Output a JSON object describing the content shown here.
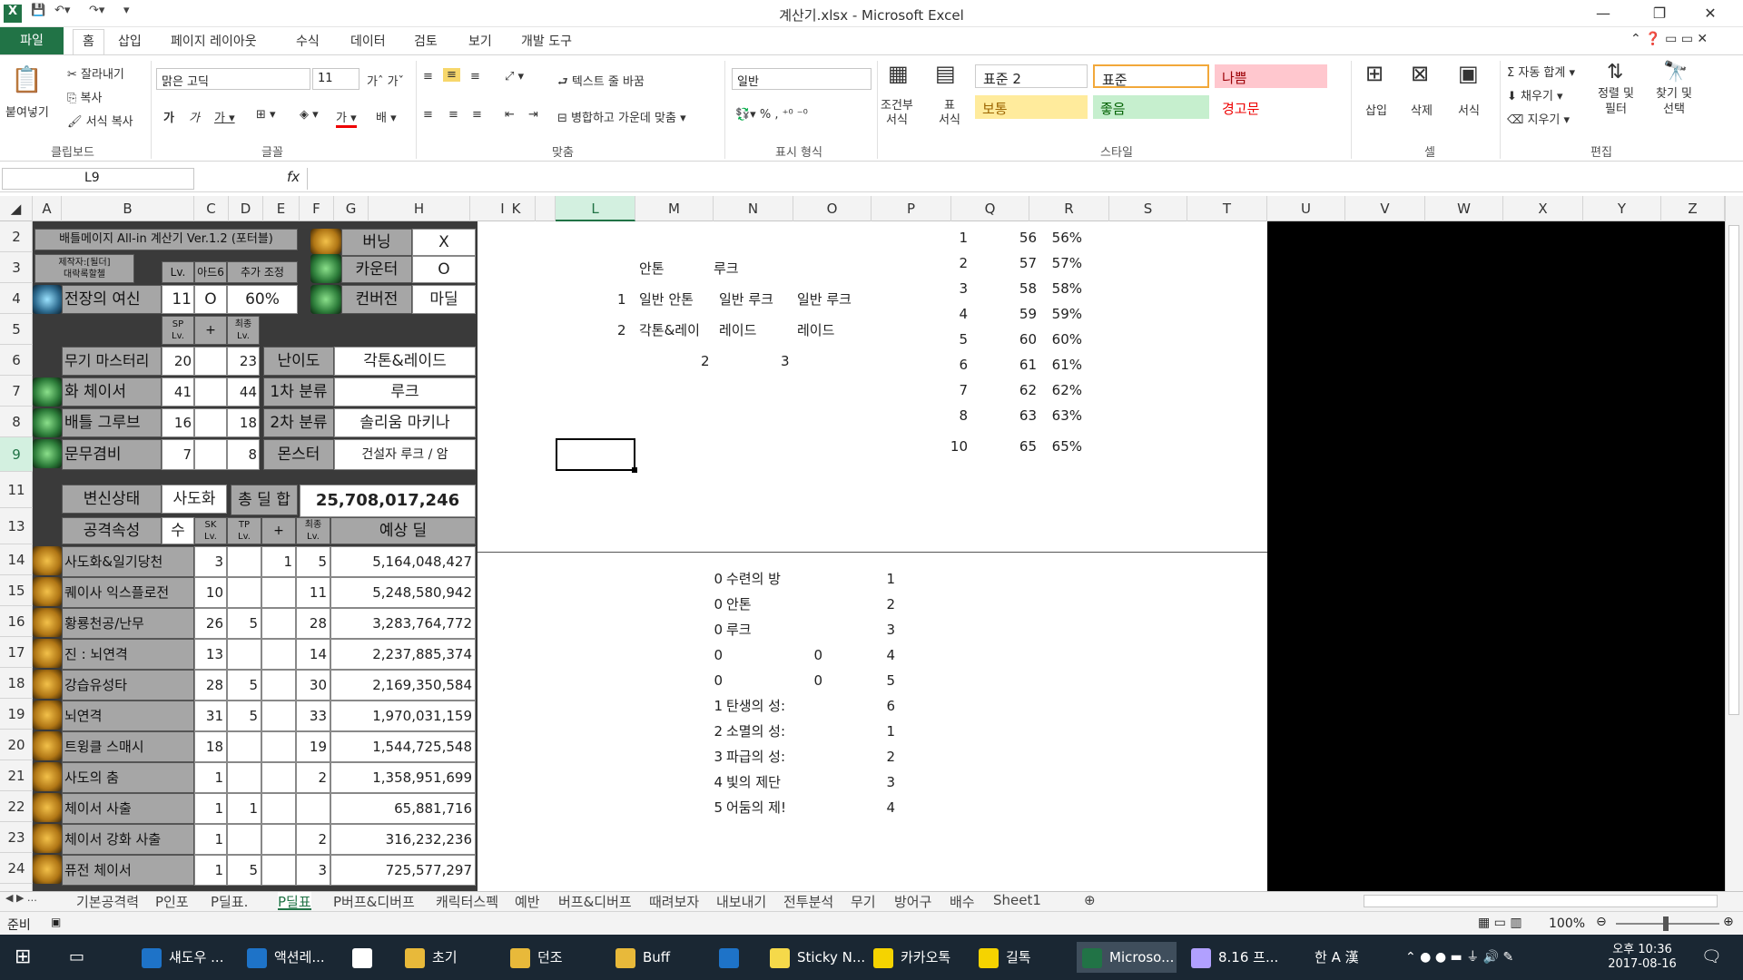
{
  "window": {
    "title": "계산기.xlsx - Microsoft Excel"
  },
  "tabs": [
    "파일",
    "홈",
    "삽입",
    "페이지 레이아웃",
    "수식",
    "데이터",
    "검토",
    "보기",
    "개발 도구"
  ],
  "ribbon": {
    "clipboard": {
      "paste": "붙여넣기",
      "cut": "잘라내기",
      "copy": "복사",
      "format_copy": "서식 복사",
      "label": "클립보드"
    },
    "font": {
      "name": "맑은 고딕",
      "size": "11",
      "label": "글꼴"
    },
    "align": {
      "wrap": "텍스트 줄 바꿈",
      "merge": "병합하고 가운데 맞춤",
      "label": "맞춤"
    },
    "number": {
      "format": "일반",
      "label": "표시 형식"
    },
    "cond": {
      "cond_fmt": "조건부\n서식",
      "table_fmt": "표\n서식"
    },
    "styles": {
      "label": "스타일",
      "s1": "표준 2",
      "s2": "표준",
      "s3": "나쁨",
      "s4": "보통",
      "s5": "좋음",
      "s6": "경고문"
    },
    "cells": {
      "insert": "삽입",
      "delete": "삭제",
      "format": "서식",
      "label": "셀"
    },
    "edit": {
      "autosum": "자동 합계",
      "fill": "채우기",
      "clear": "지우기",
      "sort": "정렬 및\n필터",
      "find": "찾기 및\n선택",
      "label": "편집"
    }
  },
  "formula": {
    "namebox": "L9",
    "fx": "fx"
  },
  "columns": [
    "A",
    "B",
    "C",
    "D",
    "E",
    "F",
    "G",
    "H",
    "I",
    "J",
    "K",
    "L",
    "M",
    "N",
    "O",
    "P",
    "Q",
    "R",
    "S",
    "T",
    "U",
    "V",
    "W",
    "X",
    "Y",
    "Z"
  ],
  "rows": [
    "2",
    "3",
    "4",
    "5",
    "6",
    "7",
    "8",
    "9",
    "11",
    "13",
    "14",
    "15",
    "16",
    "17",
    "18",
    "19",
    "20",
    "21",
    "22",
    "23",
    "24"
  ],
  "calc": {
    "title": "배틀메이지 All-in 계산기 Ver.1.2 (포터블)",
    "author": "제작자:[될더]\n대락록할첼",
    "h_lv": "Lv.",
    "h_ad6": "아드6",
    "h_adj": "추가 조정",
    "buring": "버닝",
    "buring_v": "X",
    "counter": "카운터",
    "counter_v": "O",
    "convert": "컨버전",
    "convert_v": "마딜",
    "goddess": "전장의 여신",
    "goddess_lv": "11",
    "goddess_o": "O",
    "goddess_pct": "60%",
    "sp_lv": "SP\nLv.",
    "plus": "+",
    "final_lv": "최종\nLv.",
    "skills_top": [
      {
        "name": "무기 마스터리",
        "lv": "20",
        "plus": "",
        "fin": "23"
      },
      {
        "name": "화 체이서",
        "lv": "41",
        "plus": "",
        "fin": "44"
      },
      {
        "name": "배틀 그루브",
        "lv": "16",
        "plus": "",
        "fin": "18"
      },
      {
        "name": "문무겸비",
        "lv": "7",
        "plus": "",
        "fin": "8"
      }
    ],
    "difficulty": "난이도",
    "difficulty_v": "각톤&레이드",
    "cat1": "1차 분류",
    "cat1_v": "루크",
    "cat2": "2차 분류",
    "cat2_v": "솔리움 마키나",
    "monster": "몬스터",
    "monster_v": "건설자 루크 / 암",
    "transform": "변신상태",
    "transform_v": "사도화",
    "total": "총 딜 합",
    "total_v": "25,708,017,246",
    "attr": "공격속성",
    "attr_v": "수",
    "sk_lv": "SK\nLv.",
    "tp_lv": "TP\nLv.",
    "expected": "예상 딜",
    "skills": [
      {
        "name": "사도화&일기당천",
        "sk": "3",
        "tp": "",
        "plus": "1",
        "fin": "5",
        "dmg": "5,164,048,427"
      },
      {
        "name": "퀘이사 익스플로전",
        "sk": "10",
        "tp": "",
        "plus": "",
        "fin": "11",
        "dmg": "5,248,580,942"
      },
      {
        "name": "황룡천공/난무",
        "sk": "26",
        "tp": "5",
        "plus": "",
        "fin": "28",
        "dmg": "3,283,764,772"
      },
      {
        "name": "진 : 뇌연격",
        "sk": "13",
        "tp": "",
        "plus": "",
        "fin": "14",
        "dmg": "2,237,885,374"
      },
      {
        "name": "강습유성타",
        "sk": "28",
        "tp": "5",
        "plus": "",
        "fin": "30",
        "dmg": "2,169,350,584"
      },
      {
        "name": "뇌연격",
        "sk": "31",
        "tp": "5",
        "plus": "",
        "fin": "33",
        "dmg": "1,970,031,159"
      },
      {
        "name": "트윙클 스매시",
        "sk": "18",
        "tp": "",
        "plus": "",
        "fin": "19",
        "dmg": "1,544,725,548"
      },
      {
        "name": "사도의 춤",
        "sk": "1",
        "tp": "",
        "plus": "",
        "fin": "2",
        "dmg": "1,358,951,699"
      },
      {
        "name": "체이서 사출",
        "sk": "1",
        "tp": "1",
        "plus": "",
        "fin": "",
        "dmg": "65,881,716"
      },
      {
        "name": "체이서 강화 사출",
        "sk": "1",
        "tp": "",
        "plus": "",
        "fin": "2",
        "dmg": "316,232,236"
      },
      {
        "name": "퓨전 체이서",
        "sk": "1",
        "tp": "5",
        "plus": "",
        "fin": "3",
        "dmg": "725,577,297"
      }
    ]
  },
  "side": {
    "l3": "안톤",
    "m3": "루크",
    "k4": "1",
    "l4": "일반 안톤",
    "m4": "일반 루크",
    "n4": "일반 루크",
    "k5": "2",
    "l5": "각톤&레이",
    "m5": "레이드",
    "n5": "레이드",
    "l6": "2",
    "n6": "3",
    "p": [
      "1",
      "2",
      "3",
      "4",
      "5",
      "6",
      "7",
      "8",
      "10"
    ],
    "q": [
      "56",
      "57",
      "58",
      "59",
      "60",
      "61",
      "62",
      "63",
      "65"
    ],
    "r": [
      "56%",
      "57%",
      "58%",
      "59%",
      "60%",
      "61%",
      "62%",
      "63%",
      "65%"
    ],
    "list": [
      {
        "k": "0",
        "l": "수련의 방",
        "p": "1"
      },
      {
        "k": "0",
        "l": "안톤",
        "p": "2"
      },
      {
        "k": "0",
        "l": "루크",
        "p": "3"
      },
      {
        "k": "0",
        "l": "",
        "n": "0",
        "p": "4"
      },
      {
        "k": "0",
        "l": "",
        "n": "0",
        "p": "5"
      },
      {
        "k": "1",
        "l": "탄생의 성:",
        "p": "6"
      },
      {
        "k": "2",
        "l": "소멸의 성:",
        "p": "1"
      },
      {
        "k": "3",
        "l": "파급의 성:",
        "p": "2"
      },
      {
        "k": "4",
        "l": "빛의 제단",
        "p": "3"
      },
      {
        "k": "5",
        "l": "어둠의 제!",
        "p": "4"
      }
    ]
  },
  "sheet_tabs": [
    "기본공격력",
    "P인포",
    "P딜표.",
    "P딜표",
    "P버프&디버프",
    "캐릭터스펙",
    "예반",
    "버프&디버프",
    "때려보자",
    "내보내기",
    "전투분석",
    "무기",
    "방어구",
    "배수",
    "Sheet1"
  ],
  "status": {
    "ready": "준비",
    "zoom": "100%"
  },
  "taskbar": {
    "items": [
      "섀도우 ...",
      "액션레...",
      "",
      "초기",
      "던조",
      "Buff",
      "",
      "Sticky N...",
      "카카오톡",
      "길톡",
      "Microso...",
      "8.16 프..."
    ],
    "ime": "한 A 漢",
    "time": "오후 10:36",
    "date": "2017-08-16"
  },
  "colors": {
    "excel_green": "#217346",
    "dark_panel": "#3a3a3a",
    "gray_cell": "#a6a6a6"
  }
}
